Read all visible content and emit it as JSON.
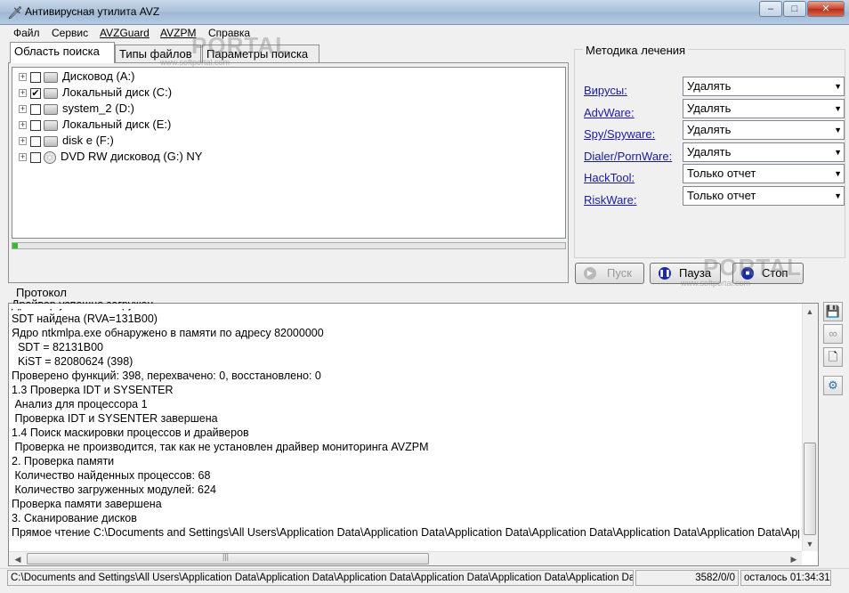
{
  "window": {
    "title": "Антивирусная утилита AVZ"
  },
  "menu": [
    {
      "label": "Файл"
    },
    {
      "label": "Сервис"
    },
    {
      "label": "AVZGuard"
    },
    {
      "label": "AVZPM"
    },
    {
      "label": "Справка"
    }
  ],
  "tabs": [
    {
      "label": "Область поиска",
      "active": true
    },
    {
      "label": "Типы файлов",
      "active": false
    },
    {
      "label": "Параметры поиска",
      "active": false
    }
  ],
  "drives": [
    {
      "label": "Дисковод (A:)",
      "checked": false,
      "icon": "floppy-drive-icon"
    },
    {
      "label": "Локальный диск (C:)",
      "checked": true,
      "icon": "windows-drive-icon"
    },
    {
      "label": "system_2 (D:)",
      "checked": false,
      "icon": "hard-drive-icon"
    },
    {
      "label": "Локальный диск (E:)",
      "checked": false,
      "icon": "hard-drive-icon"
    },
    {
      "label": "disk e (F:)",
      "checked": false,
      "icon": "hard-drive-icon"
    },
    {
      "label": "DVD RW дисковод (G:) NY",
      "checked": false,
      "icon": "dvd-drive-icon"
    }
  ],
  "scan_progress": 0.01,
  "cure": {
    "title": "Методика лечения",
    "rows": [
      {
        "label": "Вирусы:",
        "value": "Удалять"
      },
      {
        "label": "AdvWare:",
        "value": "Удалять"
      },
      {
        "label": "Spy/Spyware:",
        "value": "Удалять"
      },
      {
        "label": "Dialer/PornWare:",
        "value": "Удалять"
      },
      {
        "label": "HackTool:",
        "value": "Только отчет"
      },
      {
        "label": "RiskWare:",
        "value": "Только отчет"
      }
    ]
  },
  "buttons": {
    "start": "Пуск",
    "pause": "Пауза",
    "stop": "Стоп"
  },
  "log": {
    "label": "Протокол",
    "lines": [
      "Драйвер успешно загружен",
      "SDT найдена (RVA=131B00)",
      "Ядро ntkmlpa.exe обнаружено в памяти по адресу 82000000",
      "  SDT = 82131B00",
      "  KiST = 82080624 (398)",
      "Проверено функций: 398, перехвачено: 0, восстановлено: 0",
      "1.3 Проверка IDT и SYSENTER",
      " Анализ для процессора 1",
      " Проверка IDT и SYSENTER завершена",
      "1.4 Поиск маскировки процессов и драйверов",
      " Проверка не производится, так как не установлен драйвер мониторинга AVZPM",
      "2. Проверка памяти",
      " Количество найденных процессов: 68",
      " Количество загруженных модулей: 624",
      "Проверка памяти завершена",
      "3. Сканирование дисков",
      "Прямое чтение C:\\Documents and Settings\\All Users\\Application Data\\Application Data\\Application Data\\Application Data\\Application Data\\Application Data\\Application Data"
    ]
  },
  "status": {
    "path": "C:\\Documents and Settings\\All Users\\Application Data\\Application Data\\Application Data\\Application Data\\Application Data\\Application Data\\Applic",
    "count": "3582/0/0",
    "remaining": "осталось 01:34:31"
  },
  "watermark": {
    "text": "PORTAL",
    "url": "www.softportal.com"
  }
}
